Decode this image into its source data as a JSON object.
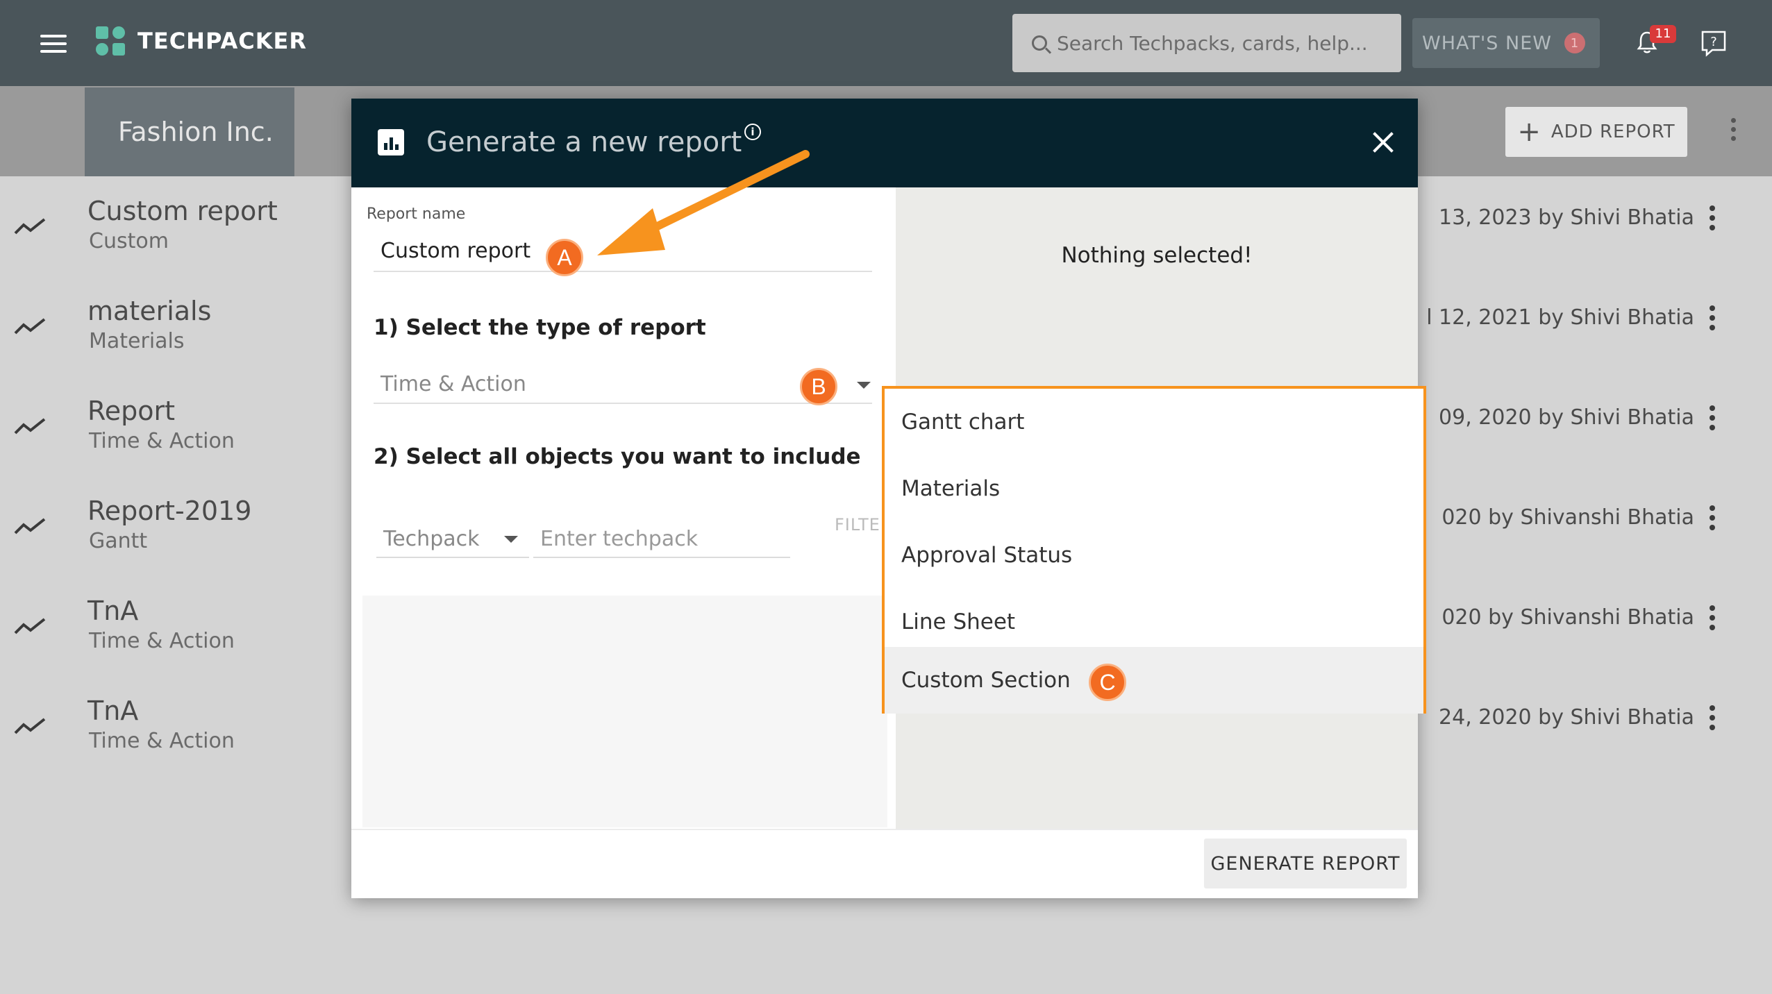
{
  "app": {
    "brand": "TECHPACKER",
    "search_placeholder": "Search Techpacks, cards, help...",
    "whats_new": "WHAT'S NEW",
    "whats_new_count": "1",
    "notifications_count": "11"
  },
  "subheader": {
    "company": "Fashion Inc.",
    "add_report": "ADD REPORT"
  },
  "reports": [
    {
      "title": "Custom report",
      "type": "Custom",
      "meta": "13, 2023 by Shivi Bhatia"
    },
    {
      "title": "materials",
      "type": "Materials",
      "meta": "l 12, 2021 by Shivi Bhatia"
    },
    {
      "title": "Report",
      "type": "Time & Action",
      "meta": "09, 2020 by Shivi Bhatia"
    },
    {
      "title": "Report-2019",
      "type": "Gantt",
      "meta": "020 by Shivanshi Bhatia"
    },
    {
      "title": "TnA",
      "type": "Time & Action",
      "meta": "020 by Shivanshi Bhatia"
    },
    {
      "title": "TnA",
      "type": "Time & Action",
      "meta": "24, 2020 by Shivi Bhatia"
    }
  ],
  "modal": {
    "title": "Generate a new report",
    "report_name_label": "Report name",
    "report_name_value": "Custom report",
    "step1": "1) Select the type of report",
    "type_value": "Time & Action",
    "step2": "2) Select all objects you want to include",
    "techpack_select": "Techpack",
    "techpack_placeholder": "Enter techpack",
    "filter_label": "FILTER",
    "nothing_selected": "Nothing selected!",
    "generate": "GENERATE REPORT"
  },
  "type_menu": {
    "options": [
      "Gantt chart",
      "Materials",
      "Approval Status",
      "Line Sheet",
      "Custom Section"
    ],
    "highlighted": "Custom Section"
  },
  "markers": {
    "a": "A",
    "b": "B",
    "c": "C"
  },
  "colors": {
    "topbar": "#4a555a",
    "modal_header": "#06232e",
    "accent_orange": "#f7931e",
    "marker": "#f26b21",
    "logo": "#5fbfa8"
  },
  "icons": [
    "menu-icon",
    "logo-icon",
    "search-icon",
    "bell-icon",
    "help-icon",
    "plus-icon",
    "more-vert-icon",
    "trend-icon",
    "bar-chart-icon",
    "info-icon",
    "close-icon",
    "caret-down-icon"
  ]
}
